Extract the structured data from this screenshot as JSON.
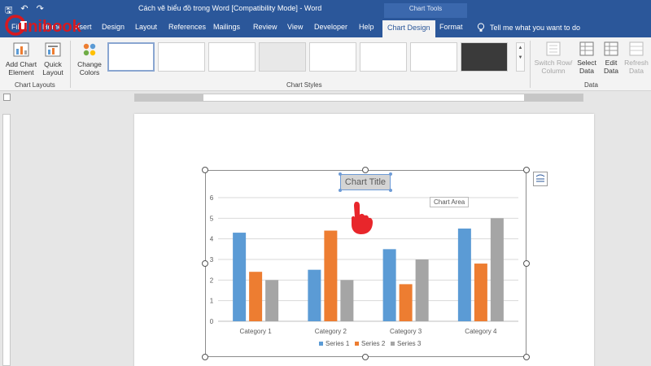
{
  "titlebar": {
    "document_title": "Cách vẽ biểu đồ trong Word [Compatibility Mode]  -  Word",
    "contextual_group": "Chart Tools"
  },
  "logo": {
    "text": "unibook",
    "color": "#d71920"
  },
  "tabs": [
    {
      "label": "File"
    },
    {
      "label": "Home"
    },
    {
      "label": "Insert"
    },
    {
      "label": "Design"
    },
    {
      "label": "Layout"
    },
    {
      "label": "References"
    },
    {
      "label": "Mailings"
    },
    {
      "label": "Review"
    },
    {
      "label": "View"
    },
    {
      "label": "Developer"
    },
    {
      "label": "Help"
    },
    {
      "label": "Chart Design"
    },
    {
      "label": "Format"
    }
  ],
  "tellme": {
    "text": "Tell me what you want to do",
    "icon": "lightbulb-icon"
  },
  "ribbon": {
    "add_chart_element": "Add Chart Element",
    "quick_layout": "Quick Layout",
    "change_colors": "Change Colors",
    "switch_row_column": "Switch Row/ Column",
    "select_data": "Select Data",
    "edit_data": "Edit Data",
    "refresh_data": "Refresh Data",
    "groups": {
      "chart_layouts": "Chart Layouts",
      "chart_styles": "Chart Styles",
      "data": "Data"
    }
  },
  "tooltip": "Chart Area",
  "colors": {
    "accent": "#2b579a",
    "series1": "#5b9bd5",
    "series2": "#ed7d31",
    "series3": "#a5a5a5",
    "gridline": "#d9d9d9",
    "title_text": "#595959"
  },
  "chart_data": {
    "type": "bar",
    "title": "Chart Title",
    "categories": [
      "Category 1",
      "Category 2",
      "Category 3",
      "Category 4"
    ],
    "series": [
      {
        "name": "Series 1",
        "values": [
          4.3,
          2.5,
          3.5,
          4.5
        ]
      },
      {
        "name": "Series 2",
        "values": [
          2.4,
          4.4,
          1.8,
          2.8
        ]
      },
      {
        "name": "Series 3",
        "values": [
          2,
          2,
          3,
          5
        ]
      }
    ],
    "ylim": [
      0,
      6
    ],
    "yticks": [
      0,
      1,
      2,
      3,
      4,
      5,
      6
    ],
    "grid": true,
    "legend": "bottom"
  }
}
